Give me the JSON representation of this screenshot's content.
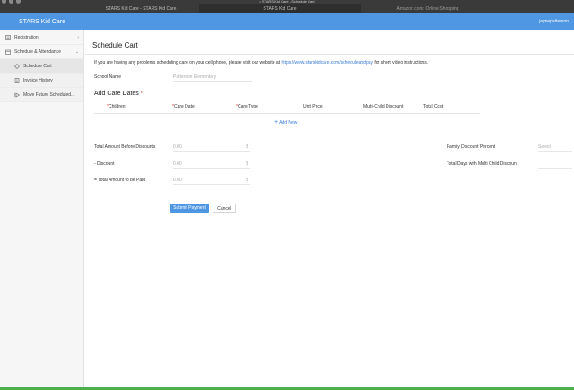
{
  "browser": {
    "window_title": "• STARS Kid Care - Schedule Cart",
    "tabs": [
      "STARS Kid Care - STARS Kid Care",
      "STARS Kid Care",
      "Amazon.com: Online Shopping"
    ]
  },
  "header": {
    "brand": "STARS Kid Care",
    "user": "jaynepatterson"
  },
  "sidebar": {
    "items": [
      {
        "label": "Registration",
        "icon": "registration-icon",
        "chevron": "›"
      },
      {
        "label": "Schedule & Attendance",
        "icon": "calendar-icon",
        "chevron": "⌄"
      },
      {
        "label": "Schedule Cart",
        "icon": "cart-icon"
      },
      {
        "label": "Invoice History",
        "icon": "invoice-icon"
      },
      {
        "label": "Move Future Scheduled...",
        "icon": "move-icon"
      }
    ]
  },
  "main": {
    "title": "Schedule Cart",
    "info_text": "If you are having any problems scheduling care on your cell phone, please visit our website at",
    "info_link": "https://www.starskidcare.com/scheduleandpay",
    "info_suffix": "for short video instructions.",
    "school_label": "School Name",
    "school_value": "Patterson Elementary",
    "care_dates_title": "Add Care Dates",
    "required_mark": "*",
    "columns": [
      "Children",
      "Care Date",
      "Care Type",
      "Unit Price",
      "Multi-Child Discount",
      "Total Cost"
    ],
    "add_new": "Add New",
    "totals": [
      {
        "label": "Total Amount Before Discounts",
        "value": "0.00",
        "suffix": "$"
      },
      {
        "label": "- Discount",
        "value": "0.00",
        "suffix": "$"
      },
      {
        "label": "= Total Amount to be Paid",
        "value": "0.00",
        "suffix": "$"
      }
    ],
    "family_discount_label": "Family Discount Percent",
    "family_discount_placeholder": "Select",
    "multi_child_days_label": "Total Days with Multi Child Discount",
    "submit_label": "Submit Payment",
    "cancel_label": "Cancel"
  },
  "colors": {
    "accent": "#4f97e3",
    "link": "#3a7bd5",
    "bottom_bar": "#4caf50"
  }
}
